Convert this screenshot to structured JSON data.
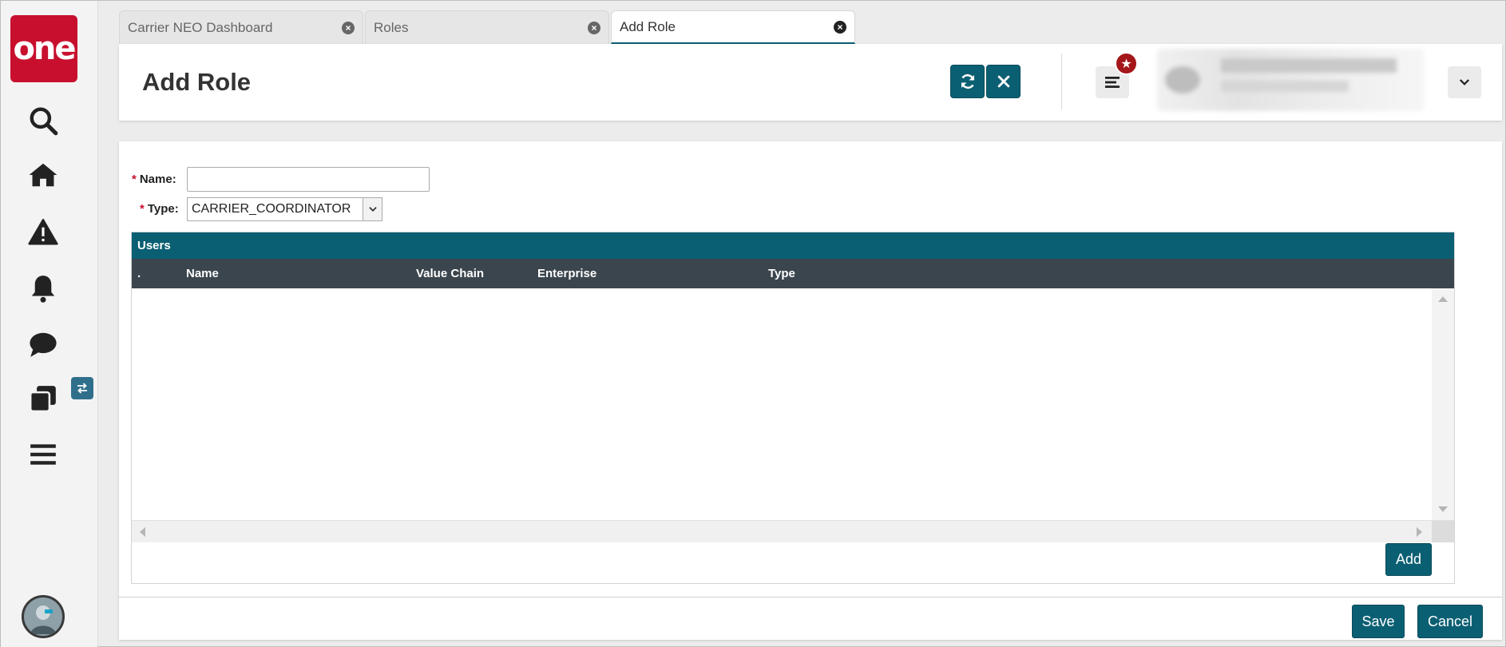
{
  "brand": {
    "logo_text": "one",
    "color": "#c8102e"
  },
  "sidebar": {
    "items": [
      {
        "name": "search",
        "icon": "search-icon"
      },
      {
        "name": "home",
        "icon": "home-icon"
      },
      {
        "name": "alerts",
        "icon": "warning-icon"
      },
      {
        "name": "notifications",
        "icon": "bell-icon"
      },
      {
        "name": "messages",
        "icon": "chat-icon"
      },
      {
        "name": "workspaces",
        "icon": "copy-icon"
      },
      {
        "name": "menu",
        "icon": "hamburger-icon"
      }
    ],
    "switch_badge_icon": "swap-icon"
  },
  "tabs": [
    {
      "label": "Carrier NEO Dashboard",
      "active": false
    },
    {
      "label": "Roles",
      "active": false
    },
    {
      "label": "Add Role",
      "active": true
    }
  ],
  "header": {
    "title": "Add Role",
    "refresh_icon": "refresh-icon",
    "close_icon": "close-icon",
    "menu_icon": "hamburger-icon",
    "favorite_icon": "star-icon",
    "expand_icon": "chevron-down-icon"
  },
  "form": {
    "name_label": "Name:",
    "name_value": "",
    "type_label": "Type:",
    "type_value": "CARRIER_COORDINATOR",
    "required_marker": "*"
  },
  "users_grid": {
    "title": "Users",
    "columns": [
      ".",
      "Name",
      "Value Chain",
      "Enterprise",
      "Type"
    ],
    "rows": []
  },
  "buttons": {
    "add": "Add",
    "save": "Save",
    "cancel": "Cancel"
  },
  "colors": {
    "primary": "#0b5f73",
    "grid_header": "#3b454d",
    "required": "#c8102e"
  }
}
